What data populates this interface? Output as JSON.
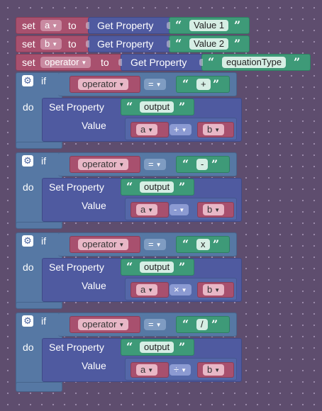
{
  "set_rows": [
    {
      "keyword": "set",
      "variable": "a",
      "to": "to",
      "getter": "Get Property",
      "value": "Value 1"
    },
    {
      "keyword": "set",
      "variable": "b",
      "to": "to",
      "getter": "Get Property",
      "value": "Value 2"
    },
    {
      "keyword": "set",
      "variable": "operator",
      "to": "to",
      "getter": "Get Property",
      "value": "equationType"
    }
  ],
  "if_blocks": [
    {
      "if_label": "if",
      "do_label": "do",
      "variable": "operator",
      "comparison": "=",
      "compare_value": "+",
      "set_property": "Set Property",
      "property_name": "output",
      "value_label": "Value",
      "left": "a",
      "operator": "+",
      "right": "b"
    },
    {
      "if_label": "if",
      "do_label": "do",
      "variable": "operator",
      "comparison": "=",
      "compare_value": "-",
      "set_property": "Set Property",
      "property_name": "output",
      "value_label": "Value",
      "left": "a",
      "operator": "-",
      "right": "b"
    },
    {
      "if_label": "if",
      "do_label": "do",
      "variable": "operator",
      "comparison": "=",
      "compare_value": "x",
      "set_property": "Set Property",
      "property_name": "output",
      "value_label": "Value",
      "left": "a",
      "operator": "×",
      "right": "b"
    },
    {
      "if_label": "if",
      "do_label": "do",
      "variable": "operator",
      "comparison": "=",
      "compare_value": "/",
      "set_property": "Set Property",
      "property_name": "output",
      "value_label": "Value",
      "left": "a",
      "operator": "÷",
      "right": "b"
    }
  ],
  "icons": {
    "gear": "gear-icon",
    "dropdown_arrow": "chevron-down-icon",
    "open_quote": "“",
    "close_quote": "”"
  },
  "colors": {
    "variable_block": "#a8506e",
    "property_block": "#4f5aa0",
    "string_block": "#3e9a78",
    "logic_block": "#5678a4",
    "workspace": "#5e4d6e"
  }
}
